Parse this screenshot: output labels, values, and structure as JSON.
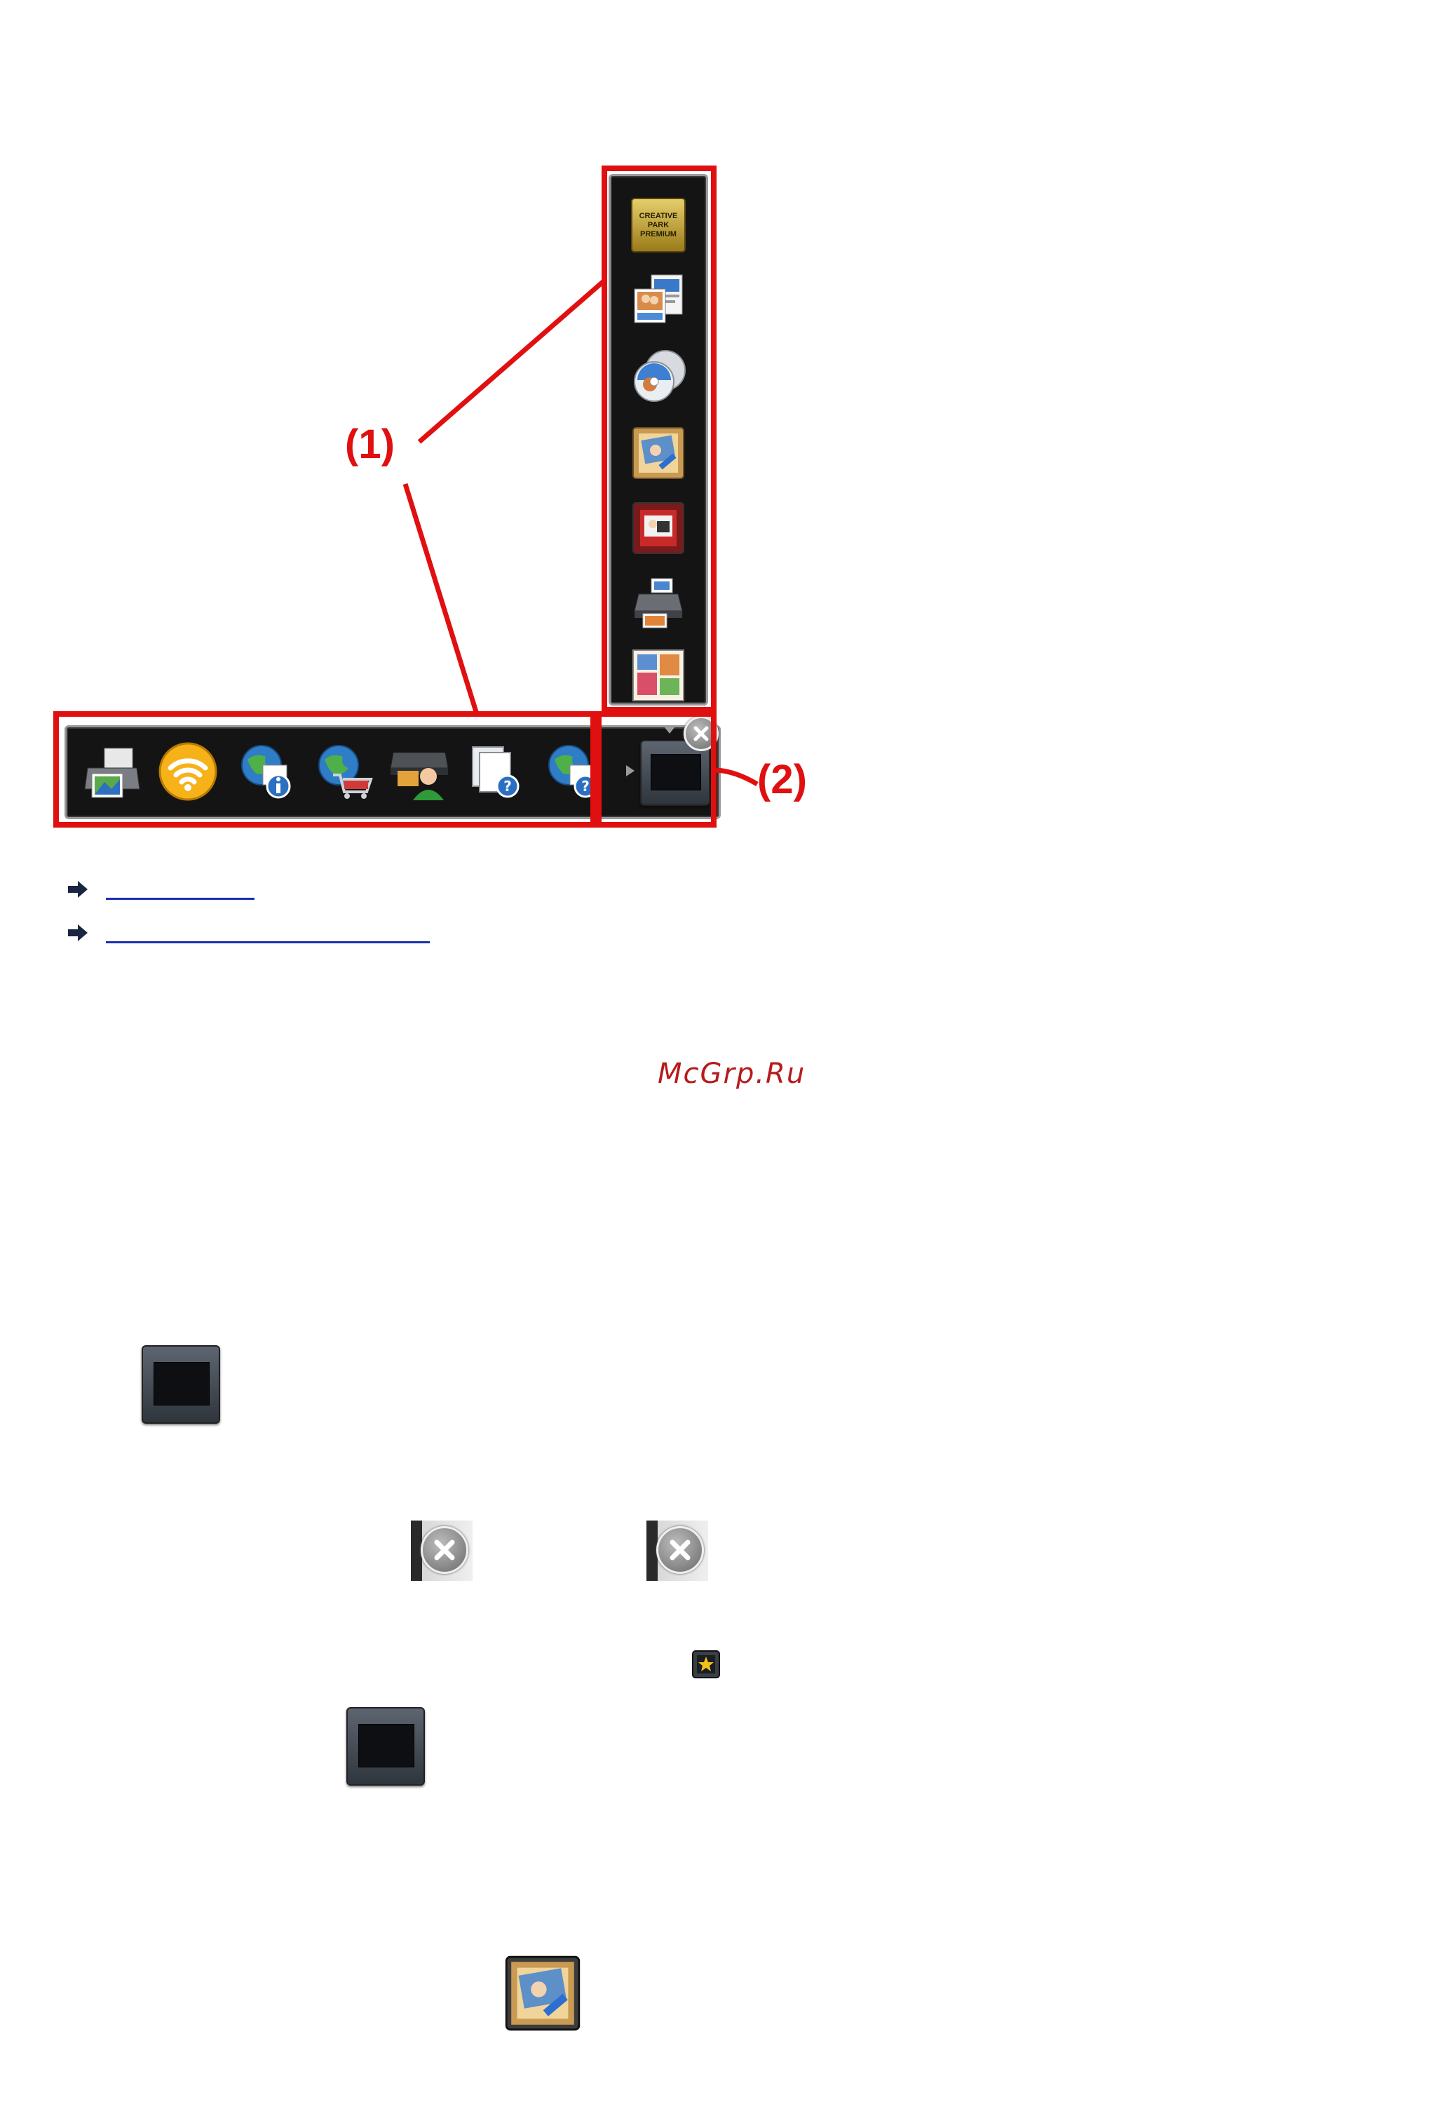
{
  "figure": {
    "callout_1": "(1)",
    "callout_2": "(2)",
    "vertical_icons": [
      {
        "name": "creative-park-premium-icon",
        "label_lines": [
          "CREATIVE",
          "PARK",
          "PREMIUM"
        ]
      },
      {
        "name": "photo-layout-icon"
      },
      {
        "name": "disc-label-icon"
      },
      {
        "name": "photo-edit-icon"
      },
      {
        "name": "photo-album-icon"
      },
      {
        "name": "printer-photo-icon"
      },
      {
        "name": "photo-collage-icon"
      }
    ],
    "horizontal_icons": [
      {
        "name": "photo-print-icon"
      },
      {
        "name": "wireless-icon"
      },
      {
        "name": "online-info-icon"
      },
      {
        "name": "online-shop-icon"
      },
      {
        "name": "printer-user-icon"
      },
      {
        "name": "document-help-icon"
      },
      {
        "name": "online-help-icon"
      }
    ]
  },
  "links": [
    {
      "text": ""
    },
    {
      "text": ""
    }
  ],
  "watermark": "McGrp.Ru",
  "colors": {
    "callout": "#e01010",
    "link": "#1a2fb0",
    "watermark": "#b51c1c"
  }
}
